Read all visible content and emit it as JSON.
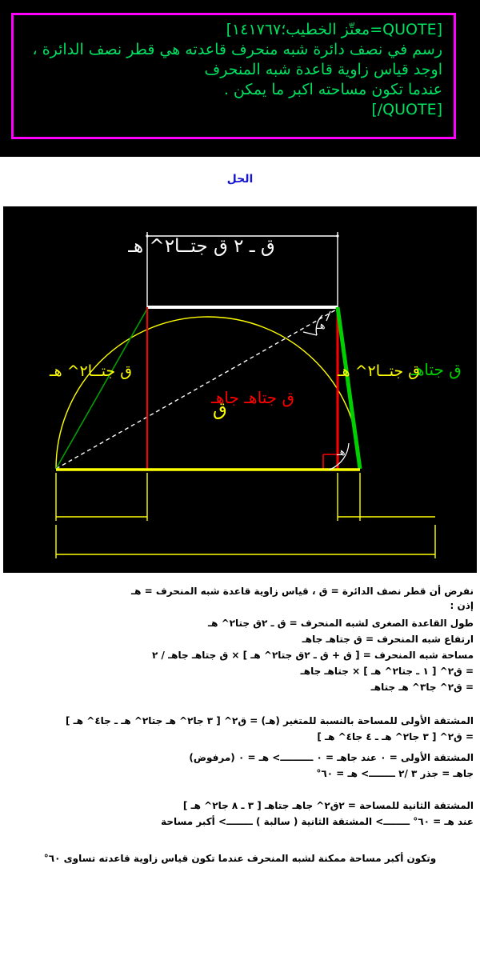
{
  "colors": {
    "banner_bg": "#000000",
    "quote_border": "#ff00ff",
    "quote_text": "#00e060",
    "heading": "#1414d2",
    "diagram_bg": "#000000",
    "arc": "#ffff00",
    "height_line": "#ff0000",
    "leg": "#00d000",
    "baseline": "#ffff00",
    "top_base": "#ffffff",
    "radius_dash": "#ffffff",
    "proof_text": "#000000"
  },
  "quote": {
    "open_tag": "[QUOTE=معتّز الخطيب؛١٤١٧٦٧]",
    "body_line1": "رسم في نصف دائرة شبه منحرف قاعدته هي قطر نصف الدائرة ،",
    "body_line2": "اوجد قياس زاوية قاعدة شبه المنحرف",
    "body_line3": "عندما تكون مساحته اكبر ما يمكن .",
    "close_tag": "[QUOTE/]",
    "full_text": "[QUOTE=معتّز الخطيب؛١٤١٧٦٧]\nرسم في نصف دائرة شبه منحرف قاعدته هي قطر نصف الدائرة ،\nاوجد قياس زاوية قاعدة شبه المنحرف\nعندما تكون مساحته اكبر ما يمكن .\n[QUOTE/]"
  },
  "solution_heading": "الحل",
  "diagram": {
    "label_top_base": "ق ـ ٢ ق جتــا٢^ هـ",
    "label_height": "ق جتاهـ جاهـ",
    "label_leg_right": "ق جتاهـ",
    "label_bottom_left": "ق جتــا٢^ هـ",
    "label_bottom_right": "ق جتــا٢^ هـ",
    "label_diameter": "ق",
    "angle_top_right": "هـ",
    "angle_bottom_right": "هـ"
  },
  "proof": {
    "lines": [
      "نفرض أن قطر نصف الدائرة = ق   ،   قياس زاوية قاعدة شبه المنحرف = هـ",
      "إذن :",
      "طول القاعدة الصغرى لشبه المنحرف = ق ـ ٢ق جتا٢^ هـ",
      "ارتفاع شبه المنحرف = ق جتاهـ جاهـ",
      "مساحة شبه المنحرف = [ ق + ق ـ ٢ق جتا٢^ هـ ] × ق جتاهـ جاهـ / ٢",
      "= ق٢^ [ ١ ـ جتا٢^ هـ ] × جتاهـ جاهـ",
      "= ق٢^ جا٣^ هـ جتاهـ",
      "المشتقة الأولى للمساحة بالنسبة للمتغير (هـ) = ق٢^ [ ٣ جا٢^ هـ جتا٢^ هـ ـ جا٤^ هـ ]",
      "= ق٢^ [ ٣ جا٢^ هـ ـ ٤ جا٤^ هـ ]",
      "المشتقة الأولى = ٠   عند جاهـ = ٠   ــــــــــ>  هـ = ٠  (مرفوض)",
      "جاهـ = جذر ٣ /٢   ــــــــ>  هـ = ٦٠°",
      "المشتقة الثانية للمساحة = ٢ق٢^ جاهـ جتاهـ [ ٣ ـ ٨ جا٢^ هـ ]",
      "عند  هـ = ٦٠°   ــــــــ>  المشتقة الثانية ( سالبة )  ــــــــ>  أكبر مساحة",
      "وتكون أكبر مساحة ممكنة لشبه المنحرف عندما تكون قياس زاوية قاعدته تساوى  ٦٠°"
    ]
  }
}
